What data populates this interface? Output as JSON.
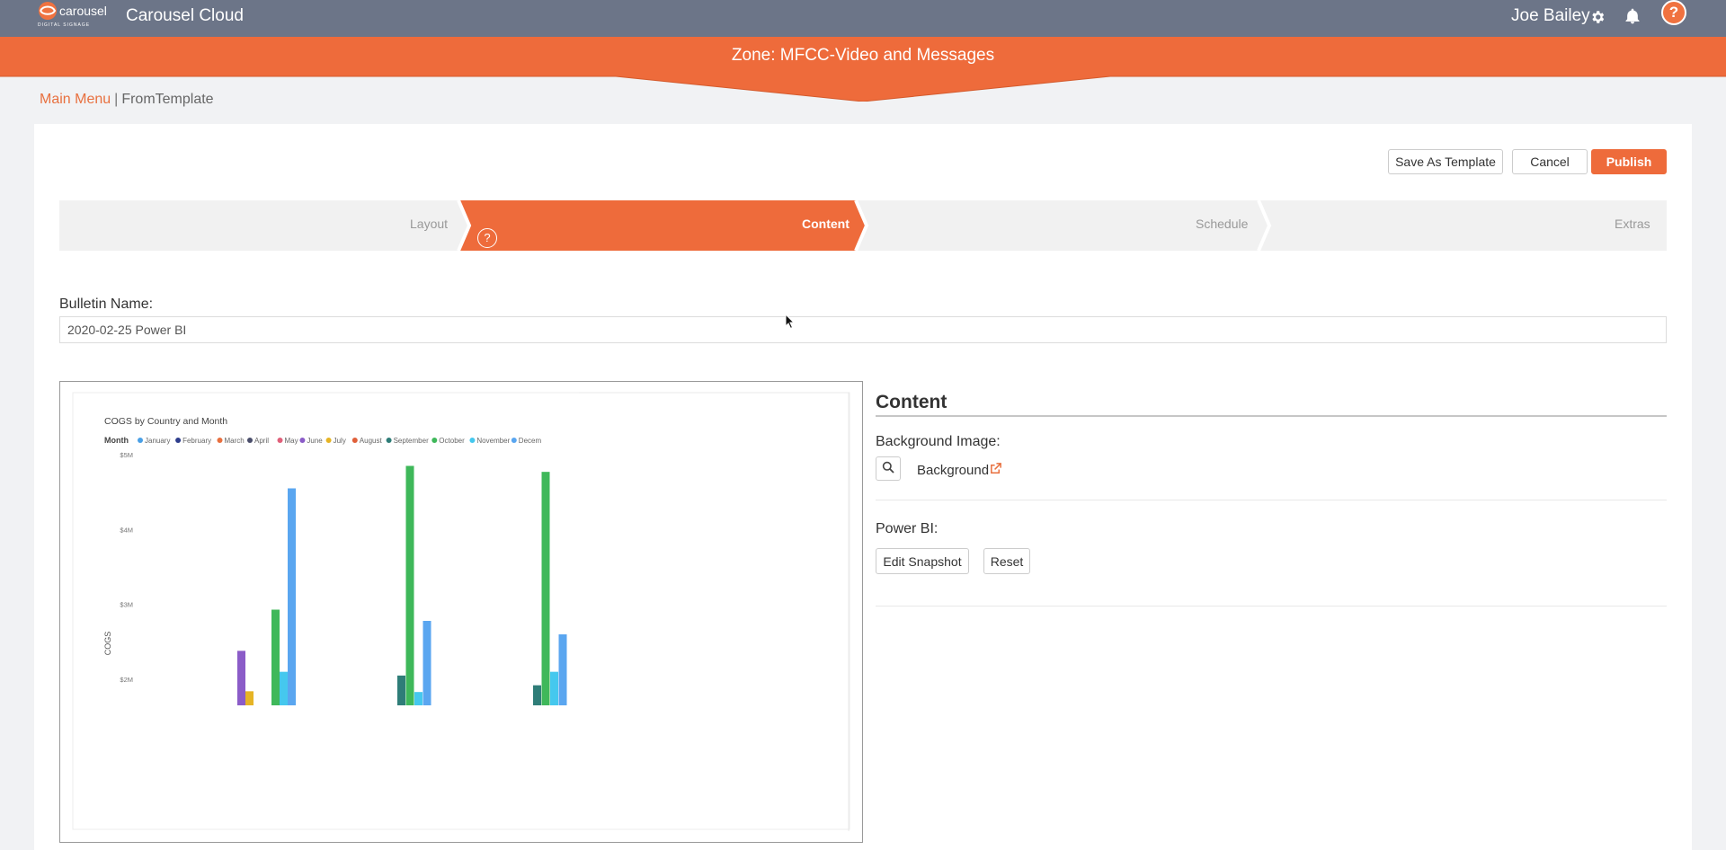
{
  "header": {
    "logo_text": "carousel",
    "logo_subtext": "DIGITAL SIGNAGE",
    "app_title": "Carousel Cloud",
    "user_name": "Joe Bailey",
    "help_label": "?"
  },
  "zone": {
    "title": "Zone: MFCC-Video and Messages"
  },
  "breadcrumb": {
    "main": "Main Menu",
    "separator": "|",
    "current": "FromTemplate"
  },
  "toolbar": {
    "save_template": "Save As Template",
    "cancel": "Cancel",
    "publish": "Publish"
  },
  "wizard": {
    "steps": [
      {
        "label": "Layout",
        "active": false
      },
      {
        "label": "Content",
        "active": true
      },
      {
        "label": "Schedule",
        "active": false
      },
      {
        "label": "Extras",
        "active": false
      }
    ],
    "help_label": "?"
  },
  "bulletin": {
    "label": "Bulletin Name:",
    "value": "2020-02-25 Power BI"
  },
  "content_panel": {
    "heading": "Content",
    "background_label": "Background Image:",
    "background_name": "Background",
    "powerbi_label": "Power BI:",
    "edit_snapshot": "Edit Snapshot",
    "reset": "Reset"
  },
  "colors": {
    "accent": "#ee6b3b",
    "topbar": "#6c7588",
    "page_bg": "#f1f2f4"
  },
  "chart_data": {
    "type": "bar",
    "title": "COGS by Country and Month",
    "legend_title": "Month",
    "legend_placement": "top-left",
    "ylabel": "COGS",
    "yticks": [
      "$2M",
      "$3M",
      "$4M",
      "$5M"
    ],
    "ylim": [
      1.65,
      5
    ],
    "series": [
      {
        "name": "January",
        "color": "#4aa0e6"
      },
      {
        "name": "February",
        "color": "#2e3d8c"
      },
      {
        "name": "March",
        "color": "#e8703f"
      },
      {
        "name": "April",
        "color": "#4a4e6b"
      },
      {
        "name": "May",
        "color": "#e0607a"
      },
      {
        "name": "June",
        "color": "#8b5cc8"
      },
      {
        "name": "July",
        "color": "#e6b425"
      },
      {
        "name": "August",
        "color": "#e0603a"
      },
      {
        "name": "September",
        "color": "#2f7d78"
      },
      {
        "name": "October",
        "color": "#3fb85a"
      },
      {
        "name": "November",
        "color": "#45c8ee"
      },
      {
        "name": "Decem",
        "color": "#5aa6f0"
      }
    ],
    "groups": [
      {
        "bars": [
          {
            "series": "June",
            "value": 2.38
          },
          {
            "series": "July",
            "value": 1.84
          },
          {
            "series": "October",
            "value": 2.93
          },
          {
            "series": "November",
            "value": 2.1
          },
          {
            "series": "Decem",
            "value": 4.55
          }
        ]
      },
      {
        "bars": [
          {
            "series": "September",
            "value": 2.05
          },
          {
            "series": "October",
            "value": 4.85
          },
          {
            "series": "November",
            "value": 1.83
          },
          {
            "series": "Decem",
            "value": 2.78
          }
        ]
      },
      {
        "bars": [
          {
            "series": "September",
            "value": 1.92
          },
          {
            "series": "October",
            "value": 4.77
          },
          {
            "series": "November",
            "value": 2.1
          },
          {
            "series": "Decem",
            "value": 2.6
          }
        ]
      }
    ]
  }
}
